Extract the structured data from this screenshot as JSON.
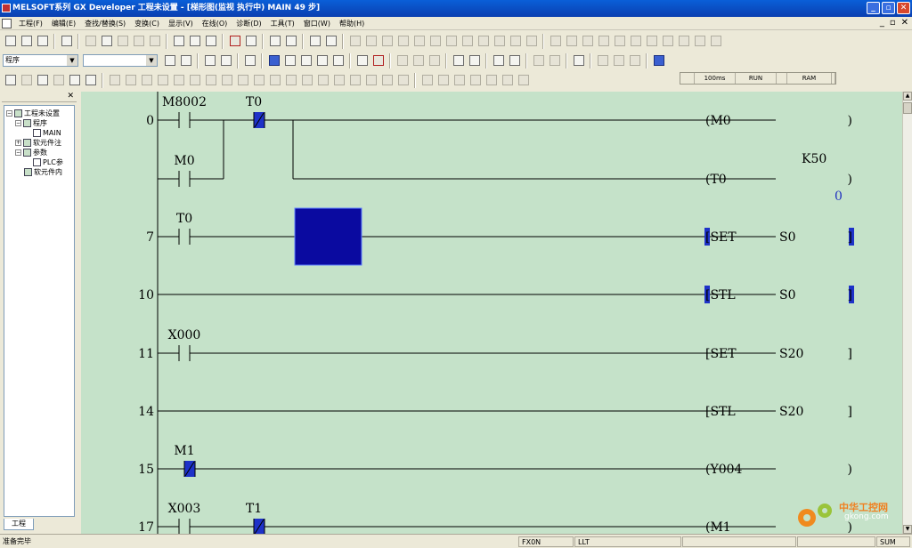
{
  "window": {
    "title": "MELSOFT系列 GX Developer 工程未设置 - [梯形图(监视 执行中)      MAIN      49 步]",
    "buttons": [
      "_",
      "▫",
      "✕"
    ]
  },
  "menubar": {
    "items": [
      "工程(F)",
      "编辑(E)",
      "查找/替换(S)",
      "变换(C)",
      "显示(V)",
      "在线(O)",
      "诊断(D)",
      "工具(T)",
      "窗口(W)",
      "帮助(H)"
    ],
    "mdi_buttons": [
      "_",
      "▫",
      "✕"
    ]
  },
  "toolbar2": {
    "program_select": "程序",
    "second_select": ""
  },
  "monitor_status": {
    "cells": [
      "",
      "100ms",
      "RUN",
      "",
      "RAM",
      ""
    ]
  },
  "project_panel": {
    "close_label": "✕",
    "tree": [
      {
        "label": "工程未设置",
        "level": 0,
        "toggle": "⊟"
      },
      {
        "label": "程序",
        "level": 1,
        "toggle": "⊟"
      },
      {
        "label": "MAIN",
        "level": 2,
        "toggle": ""
      },
      {
        "label": "软元件注",
        "level": 1,
        "toggle": "⊞"
      },
      {
        "label": "参数",
        "level": 1,
        "toggle": "⊟"
      },
      {
        "label": "PLC参",
        "level": 2,
        "toggle": ""
      },
      {
        "label": "软元件内",
        "level": 1,
        "toggle": ""
      }
    ],
    "tab_label": "工程"
  },
  "ladder": {
    "rungs": [
      {
        "step": "0",
        "contacts": [
          {
            "name": "M8002",
            "kind": "NO",
            "on": false
          },
          {
            "name": "T0",
            "kind": "NC",
            "on": true
          }
        ],
        "coil": "(M0",
        "coil_end": ")"
      },
      {
        "step": "",
        "contacts": [
          {
            "name": "M0",
            "kind": "NO",
            "on": false
          }
        ],
        "coil": "(T0",
        "coil_end": ")",
        "coil_param": "K50",
        "monitor_value": "0"
      },
      {
        "step": "7",
        "contacts": [
          {
            "name": "T0",
            "kind": "NO",
            "on": false
          }
        ],
        "coil": "[SET",
        "operand": "S0",
        "coil_end": "]",
        "cursor": true
      },
      {
        "step": "10",
        "contacts": [],
        "coil": "[STL",
        "operand": "S0",
        "coil_end": "]"
      },
      {
        "step": "11",
        "contacts": [
          {
            "name": "X000",
            "kind": "NO",
            "on": false
          }
        ],
        "coil": "[SET",
        "operand": "S20",
        "coil_end": "]"
      },
      {
        "step": "14",
        "contacts": [],
        "coil": "[STL",
        "operand": "S20",
        "coil_end": "]"
      },
      {
        "step": "15",
        "contacts": [
          {
            "name": "M1",
            "kind": "NC",
            "on": true
          }
        ],
        "coil": "(Y004",
        "coil_end": ")"
      },
      {
        "step": "17",
        "contacts": [
          {
            "name": "X003",
            "kind": "NO",
            "on": false
          },
          {
            "name": "T1",
            "kind": "NC",
            "on": true
          }
        ],
        "coil": "(M1",
        "coil_end": ")"
      }
    ]
  },
  "statusbar": {
    "message": "准备完毕",
    "cpu": "FX0N",
    "mode": "LLT",
    "state": "SUM"
  },
  "watermark": {
    "cn": "中华工控网",
    "en": "gkong.com"
  },
  "colors": {
    "ladder_bg": "#c5e2c9",
    "energized": "#1e32c8",
    "cursor": "#0a0aa0",
    "titlebar": "#0a4fc8"
  }
}
